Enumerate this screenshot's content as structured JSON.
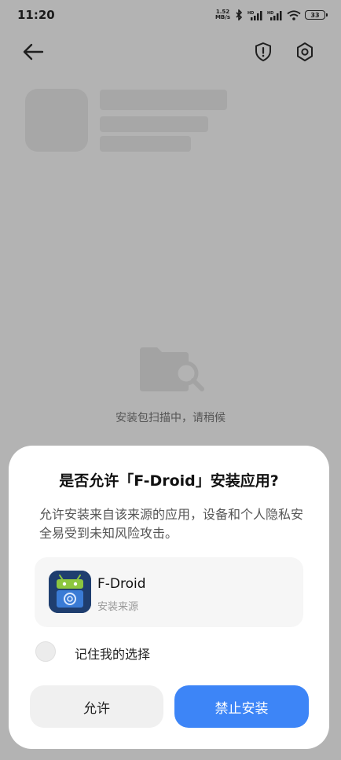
{
  "status_bar": {
    "time": "11:20",
    "speed_value": "1.52",
    "speed_unit": "MB/s",
    "battery": "33",
    "icons": [
      "bluetooth-icon",
      "signal-hd-icon",
      "signal-hd-icon",
      "wifi-icon",
      "battery-icon"
    ]
  },
  "toolbar": {
    "back_icon": "arrow-left-icon",
    "shield_icon": "shield-alert-icon",
    "settings_icon": "gear-icon"
  },
  "scan": {
    "icon": "folder-search-icon",
    "text": "安装包扫描中，请稍候"
  },
  "dialog": {
    "title": "是否允许「F-Droid」安装应用?",
    "description": "允许安装来自该来源的应用，设备和个人隐私安全易受到未知风险攻击。",
    "app": {
      "name": "F-Droid",
      "subtitle": "安装来源",
      "icon": "fdroid-app-icon"
    },
    "remember_label": "记住我的选择",
    "allow_button": "允许",
    "block_button": "禁止安装"
  },
  "colors": {
    "accent": "#3d85f7",
    "scrim": "#b3b3b3",
    "sheet": "#ffffff"
  }
}
